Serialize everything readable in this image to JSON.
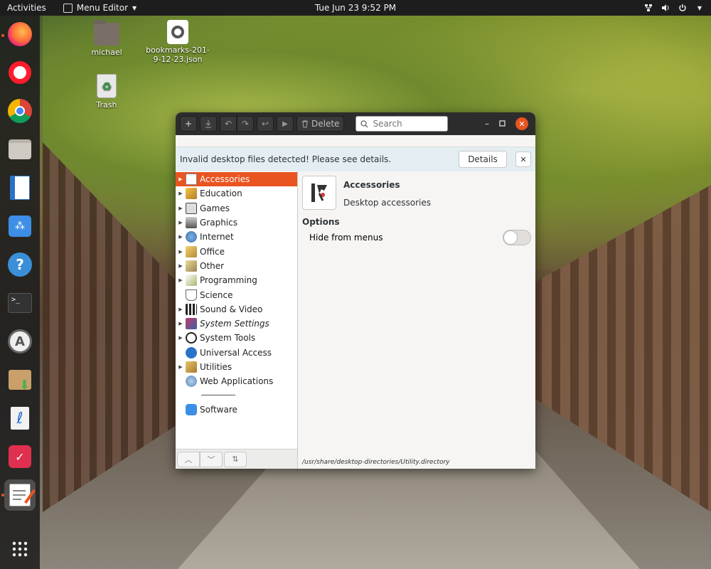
{
  "topbar": {
    "activities": "Activities",
    "app_name": "Menu Editor",
    "clock": "Tue Jun 23   9:52 PM"
  },
  "desktop": {
    "icons": [
      {
        "label": "michael",
        "icon": "home-folder-icon"
      },
      {
        "label": "bookmarks-201-9-12-23.json",
        "icon": "json-file-icon"
      },
      {
        "label": "Trash",
        "icon": "trash-icon"
      }
    ]
  },
  "dock": {
    "items": [
      "firefox",
      "opera",
      "chrome",
      "files",
      "libreoffice-writer",
      "software-store",
      "help",
      "terminal",
      "software-updater",
      "archive-manager",
      "writer-app",
      "todo-app",
      "menu-editor",
      "show-apps"
    ]
  },
  "window": {
    "toolbar": {
      "delete_label": "Delete",
      "search_placeholder": "Search"
    },
    "infobar": {
      "message": "Invalid desktop files detected! Please see details.",
      "details_label": "Details",
      "close_label": "✕"
    },
    "tree": [
      {
        "label": "Accessories",
        "expander": true,
        "selected": true
      },
      {
        "label": "Education",
        "expander": true
      },
      {
        "label": "Games",
        "expander": true
      },
      {
        "label": "Graphics",
        "expander": true
      },
      {
        "label": "Internet",
        "expander": true
      },
      {
        "label": "Office",
        "expander": true
      },
      {
        "label": "Other",
        "expander": true
      },
      {
        "label": "Programming",
        "expander": true
      },
      {
        "label": "Science",
        "expander": false
      },
      {
        "label": "Sound & Video",
        "expander": true
      },
      {
        "label": "System Settings",
        "expander": true,
        "italic": true
      },
      {
        "label": "System Tools",
        "expander": true
      },
      {
        "label": "Universal Access",
        "expander": false
      },
      {
        "label": "Utilities",
        "expander": true
      },
      {
        "label": "Web Applications",
        "expander": false
      }
    ],
    "tree_after_separator": [
      {
        "label": "Software",
        "expander": false
      }
    ],
    "detail": {
      "name": "Accessories",
      "comment": "Desktop accessories",
      "options_title": "Options",
      "hide_label": "Hide from menus",
      "hide_enabled": false,
      "path": "/usr/share/desktop-directories/Utility.directory"
    }
  },
  "colors": {
    "accent": "#e95420",
    "topbar": "#1d1d1d",
    "headerbar": "#2c2c2c"
  }
}
